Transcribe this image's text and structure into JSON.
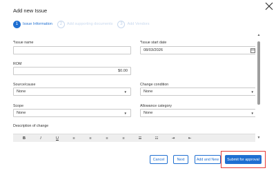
{
  "dialog": {
    "title": "Add new Issue"
  },
  "steps": [
    {
      "number": "1",
      "label": "Issue Information"
    },
    {
      "number": "2",
      "label": "Add supporting documents"
    },
    {
      "number": "3",
      "label": "Add Vendors"
    }
  ],
  "form": {
    "issue_name": {
      "label": "*Issue name",
      "value": ""
    },
    "issue_start_date": {
      "label": "*Issue start date",
      "value": "08/03/2026"
    },
    "rom": {
      "label": "ROM",
      "value": "$0.00"
    },
    "source_cause": {
      "label": "Source/cause",
      "value": "None"
    },
    "change_condition": {
      "label": "Change condition",
      "value": "None"
    },
    "scope": {
      "label": "Scope",
      "value": "None"
    },
    "allowance_category": {
      "label": "Allowance category",
      "value": "None"
    },
    "description": {
      "label": "Description of change"
    }
  },
  "editor_toolbar": {
    "bold": "B",
    "italic": "I",
    "underline": "U",
    "icons": [
      "align-left-icon",
      "align-center-icon",
      "align-right-icon",
      "align-justify-icon",
      "bulleted-list-icon",
      "numbered-list-icon",
      "indent-icon",
      "outdent-icon"
    ]
  },
  "footer": {
    "cancel": "Cancel",
    "next": "Next",
    "add_and_new": "Add and New",
    "submit": "Submit for approval"
  },
  "colors": {
    "accent": "#1f6fd1",
    "highlight": "#e53935"
  }
}
